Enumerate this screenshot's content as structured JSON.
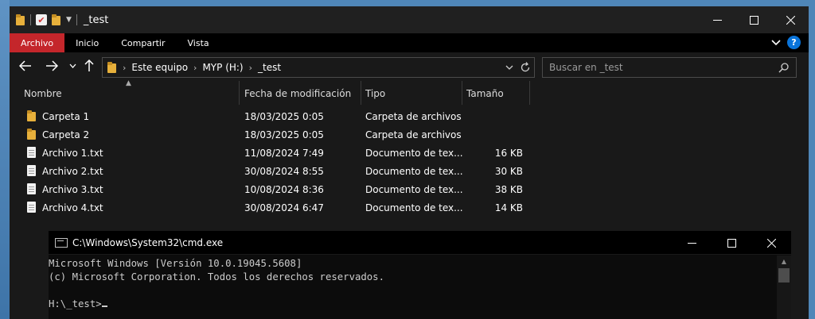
{
  "explorer": {
    "title": "_test",
    "ribbon": {
      "tabs": [
        "Archivo",
        "Inicio",
        "Compartir",
        "Vista"
      ],
      "active": "Archivo"
    },
    "address": {
      "crumbs": [
        "Este equipo",
        "MYP (H:)",
        "_test"
      ]
    },
    "search": {
      "placeholder": "Buscar en _test"
    },
    "columns": {
      "name": "Nombre",
      "date": "Fecha de modificación",
      "type": "Tipo",
      "size": "Tamaño"
    },
    "rows": [
      {
        "icon": "folder-icon",
        "name": "Carpeta 1",
        "date": "18/03/2025 0:05",
        "type": "Carpeta de archivos",
        "size": ""
      },
      {
        "icon": "folder-icon",
        "name": "Carpeta 2",
        "date": "18/03/2025 0:05",
        "type": "Carpeta de archivos",
        "size": ""
      },
      {
        "icon": "text-file-icon",
        "name": "Archivo 1.txt",
        "date": "11/08/2024 7:49",
        "type": "Documento de tex...",
        "size": "16 KB"
      },
      {
        "icon": "text-file-icon",
        "name": "Archivo 2.txt",
        "date": "30/08/2024 8:55",
        "type": "Documento de tex...",
        "size": "30 KB"
      },
      {
        "icon": "text-file-icon",
        "name": "Archivo 3.txt",
        "date": "10/08/2024 8:36",
        "type": "Documento de tex...",
        "size": "38 KB"
      },
      {
        "icon": "text-file-icon",
        "name": "Archivo 4.txt",
        "date": "30/08/2024 6:47",
        "type": "Documento de tex...",
        "size": "14 KB"
      }
    ]
  },
  "cmd": {
    "title": "C:\\Windows\\System32\\cmd.exe",
    "lines": [
      "Microsoft Windows [Versión 10.0.19045.5608]",
      "(c) Microsoft Corporation. Todos los derechos reservados.",
      "",
      "H:\\_test>"
    ]
  },
  "colors": {
    "ribbon_active": "#c4262b",
    "folder": "#e7b03b",
    "help_blue": "#0a74da"
  }
}
